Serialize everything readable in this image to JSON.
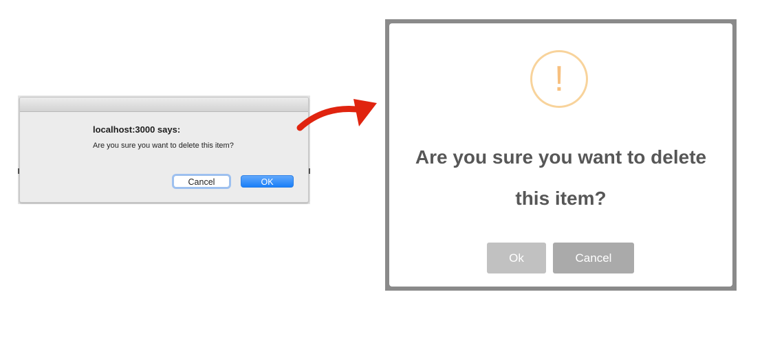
{
  "native_alert": {
    "title": "localhost:3000 says:",
    "message": "Are you sure you want to delete this item?",
    "cancel_label": "Cancel",
    "ok_label": "OK"
  },
  "custom_modal": {
    "icon": "exclamation-icon",
    "icon_glyph": "!",
    "message": "Are you sure you want to delete this item?",
    "ok_label": "Ok",
    "cancel_label": "Cancel"
  },
  "arrow": {
    "color": "#e0240f"
  },
  "colors": {
    "warning_icon": "#f8d39b",
    "native_ok_button": "#197ef8",
    "modal_ok_button": "#c1c1c1",
    "modal_cancel_button": "#aaaaaa"
  }
}
